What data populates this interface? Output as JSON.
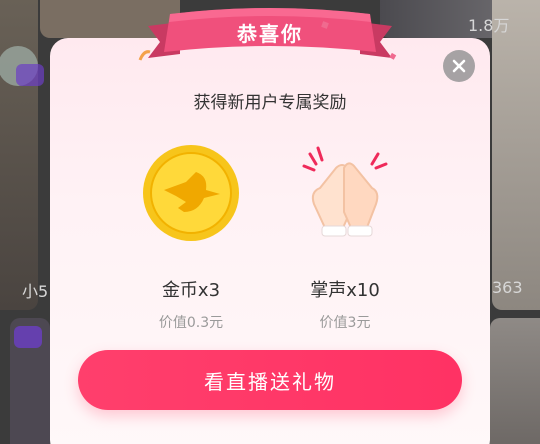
{
  "background": {
    "views_count": "1.8万",
    "left_label": "小5",
    "right_number": "363"
  },
  "modal": {
    "ribbon_title": "恭喜你",
    "subtitle": "获得新用户专属奖励",
    "rewards": [
      {
        "name": "金币x3",
        "value": "价值0.3元",
        "icon": "gold-coin-icon"
      },
      {
        "name": "掌声x10",
        "value": "价值3元",
        "icon": "clapping-hands-icon"
      }
    ],
    "cta_label": "看直播送礼物",
    "close_icon": "close-icon"
  },
  "colors": {
    "accent": "#ff3a66",
    "ribbon": "#f0507c",
    "coin": "#f7c51b"
  }
}
